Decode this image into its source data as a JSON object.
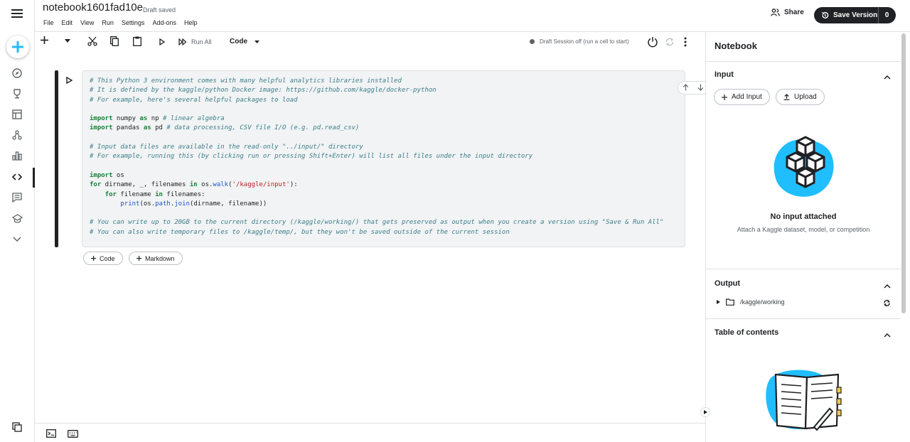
{
  "header": {
    "notebook_title": "notebook1601fad10e",
    "draft_status": "Draft saved",
    "menu": [
      "File",
      "Edit",
      "View",
      "Run",
      "Settings",
      "Add-ons",
      "Help"
    ],
    "share_label": "Share",
    "save_version_label": "Save Version",
    "save_version_count": "0"
  },
  "toolbar": {
    "run_all_label": "Run All",
    "cell_type": "Code",
    "session_status": "Draft Session off (run a cell to start)"
  },
  "cell": {
    "lines": [
      [
        {
          "t": "cm",
          "v": "# This Python 3 environment comes with many helpful analytics libraries installed"
        }
      ],
      [
        {
          "t": "cm",
          "v": "# It is defined by the kaggle/python Docker image: https://github.com/kaggle/docker-python"
        }
      ],
      [
        {
          "t": "cm",
          "v": "# For example, here's several helpful packages to load"
        }
      ],
      [],
      [
        {
          "t": "kw",
          "v": "import"
        },
        {
          "t": "",
          "v": " numpy "
        },
        {
          "t": "kw",
          "v": "as"
        },
        {
          "t": "",
          "v": " np "
        },
        {
          "t": "cm",
          "v": "# linear algebra"
        }
      ],
      [
        {
          "t": "kw",
          "v": "import"
        },
        {
          "t": "",
          "v": " pandas "
        },
        {
          "t": "kw",
          "v": "as"
        },
        {
          "t": "",
          "v": " pd "
        },
        {
          "t": "cm",
          "v": "# data processing, CSV file I/O (e.g. pd.read_csv)"
        }
      ],
      [],
      [
        {
          "t": "cm",
          "v": "# Input data files are available in the read-only \"../input/\" directory"
        }
      ],
      [
        {
          "t": "cm",
          "v": "# For example, running this (by clicking run or pressing Shift+Enter) will list all files under the input directory"
        }
      ],
      [],
      [
        {
          "t": "kw",
          "v": "import"
        },
        {
          "t": "",
          "v": " os"
        }
      ],
      [
        {
          "t": "kw",
          "v": "for"
        },
        {
          "t": "",
          "v": " dirname, _, filenames "
        },
        {
          "t": "kw",
          "v": "in"
        },
        {
          "t": "",
          "v": " os."
        },
        {
          "t": "fn",
          "v": "walk"
        },
        {
          "t": "",
          "v": "("
        },
        {
          "t": "st",
          "v": "'/kaggle/input'"
        },
        {
          "t": "",
          "v": "):"
        }
      ],
      [
        {
          "t": "",
          "v": "    "
        },
        {
          "t": "kw",
          "v": "for"
        },
        {
          "t": "",
          "v": " filename "
        },
        {
          "t": "kw",
          "v": "in"
        },
        {
          "t": "",
          "v": " filenames:"
        }
      ],
      [
        {
          "t": "",
          "v": "        "
        },
        {
          "t": "fn",
          "v": "print"
        },
        {
          "t": "",
          "v": "(os."
        },
        {
          "t": "fn",
          "v": "path"
        },
        {
          "t": "",
          "v": "."
        },
        {
          "t": "fn",
          "v": "join"
        },
        {
          "t": "",
          "v": "(dirname, filename))"
        }
      ],
      [],
      [
        {
          "t": "cm",
          "v": "# You can write up to 20GB to the current directory (/kaggle/working/) that gets preserved as output when you create a version using \"Save & Run All\""
        }
      ],
      [
        {
          "t": "cm",
          "v": "# You can also write temporary files to /kaggle/temp/, but they won't be saved outside of the current session"
        }
      ]
    ]
  },
  "add_cell": {
    "code_label": "Code",
    "markdown_label": "Markdown"
  },
  "right_panel": {
    "title": "Notebook",
    "input": {
      "heading": "Input",
      "add_input_label": "Add Input",
      "upload_label": "Upload",
      "empty_title": "No input attached",
      "empty_subtitle": "Attach a Kaggle dataset, model, or competition"
    },
    "output": {
      "heading": "Output",
      "path": "/kaggle/working"
    },
    "toc": {
      "heading": "Table of contents"
    }
  },
  "colors": {
    "accent_blue": "#20beff",
    "dark": "#202124",
    "comment": "#3d7e8a",
    "keyword": "#198038",
    "string": "#ba2121"
  }
}
